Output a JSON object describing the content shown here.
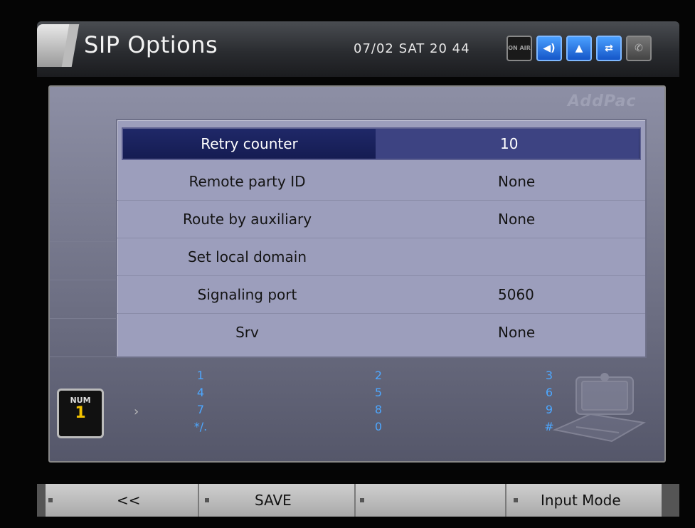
{
  "header": {
    "title": "SIP Options",
    "datetime": "07/02 SAT 20 44",
    "status_icons": [
      {
        "name": "on-air-icon",
        "text": "ON AIR"
      },
      {
        "name": "speaker-icon",
        "text": "◀)"
      },
      {
        "name": "user-icon",
        "text": "▲"
      },
      {
        "name": "network-icon",
        "text": "⇄"
      },
      {
        "name": "handset-icon",
        "text": "✆"
      }
    ]
  },
  "brand": "AddPac",
  "menu": {
    "items": [
      {
        "label": "Retry counter",
        "value": "10",
        "selected": true
      },
      {
        "label": "Remote party ID",
        "value": "None"
      },
      {
        "label": "Route by auxiliary",
        "value": "None"
      },
      {
        "label": "Set local domain",
        "value": ""
      },
      {
        "label": "Signaling port",
        "value": "5060"
      },
      {
        "label": "Srv",
        "value": "None"
      }
    ]
  },
  "input_mode": {
    "label": "NUM",
    "number": "1"
  },
  "keypad": {
    "col1": [
      "1",
      "4",
      "7",
      "*/."
    ],
    "col2": [
      "2",
      "5",
      "8",
      "0"
    ],
    "col3": [
      "3",
      "6",
      "9",
      "#"
    ]
  },
  "softkeys": {
    "back": "<<",
    "save": "SAVE",
    "empty": "",
    "input_mode": "Input Mode"
  },
  "colors": {
    "selected_row": "#1f2868",
    "panel": "#9c9ebc",
    "keypad_digits": "#4da7ff"
  }
}
